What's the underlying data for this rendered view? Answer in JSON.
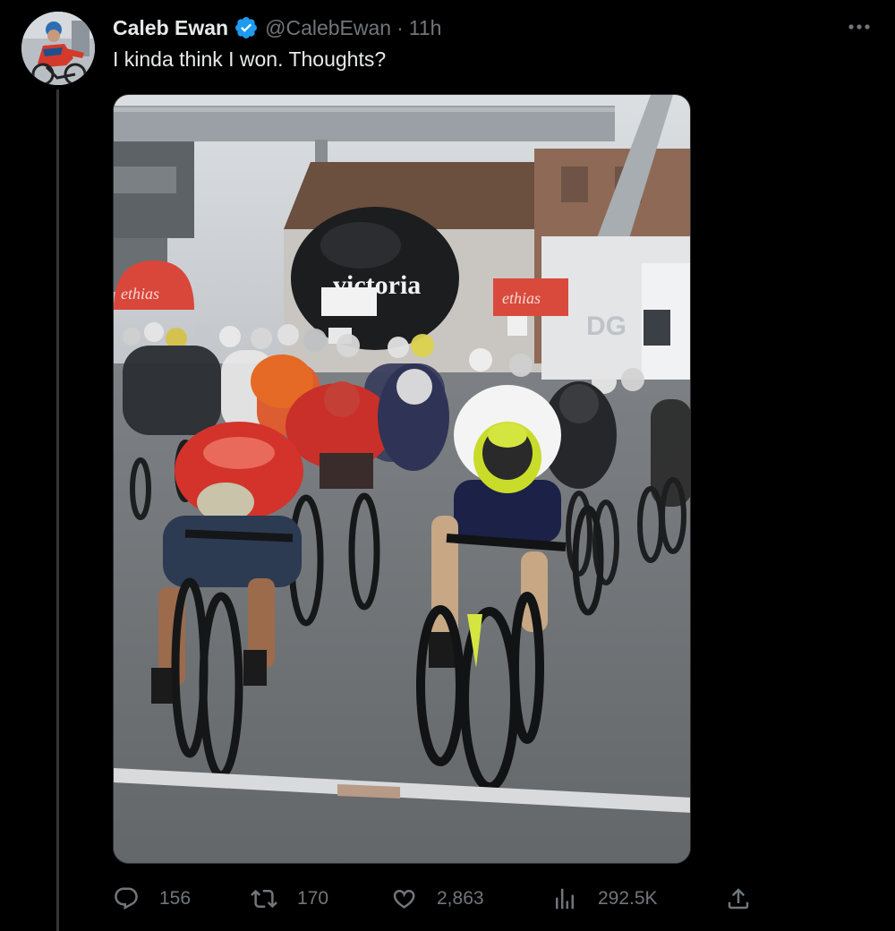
{
  "author": {
    "display_name": "Caleb Ewan",
    "handle": "@CalebEwan",
    "separator": "·",
    "time": "11h",
    "verified": true
  },
  "tweet": {
    "text": "I kinda think I won. Thoughts?"
  },
  "media": {
    "type": "video-still",
    "inflatable_text": "victoria",
    "banner_left_text": "ethias",
    "banner_right_text": "ethias",
    "truck_text": "DG"
  },
  "actions": {
    "replies": "156",
    "retweets": "170",
    "likes": "2,863",
    "views": "292.5K"
  },
  "colors": {
    "background": "#000000",
    "text_primary": "#e7e9ea",
    "text_secondary": "#71767b",
    "verified_badge": "#1d9bf0",
    "divider": "#2f3336"
  },
  "icons": [
    "more-icon",
    "verified-icon",
    "reply-icon",
    "retweet-icon",
    "like-icon",
    "views-icon",
    "share-icon"
  ]
}
